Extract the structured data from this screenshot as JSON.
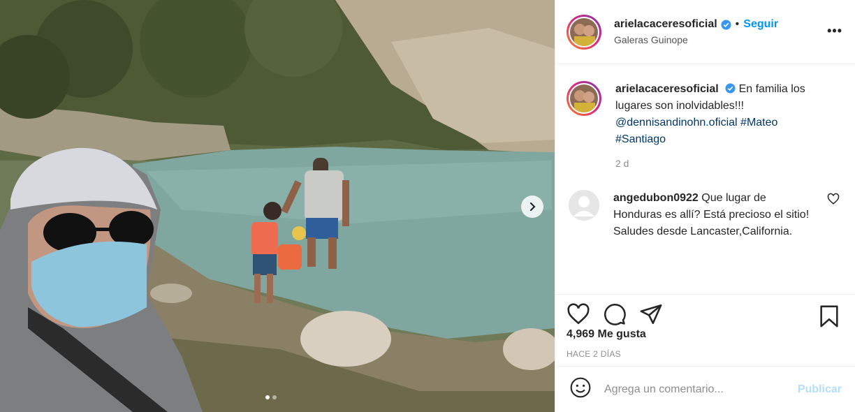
{
  "post": {
    "username": "arielacaceresoficial",
    "follow_label": "Seguir",
    "separator": "•",
    "location": "Galeras Guinope",
    "more_label": "•••"
  },
  "caption": {
    "username": "arielacaceresoficial",
    "text": "En familia los lugares son inolvidables!!!",
    "mention": "@dennisandinohn.oficial",
    "hashtag1": "#Mateo",
    "hashtag2": "#Santiago",
    "ago": "2 d"
  },
  "comment": {
    "username": "angedubon0922",
    "text": "Que lugar de Honduras es allí? Está precioso el sitio! Saludes desde Lancaster,California."
  },
  "stats": {
    "likes": "4,969 Me gusta",
    "date": "HACE 2 DÍAS"
  },
  "add_comment": {
    "placeholder": "Agrega un comentario...",
    "publish_label": "Publicar"
  },
  "colors": {
    "accent": "#0095f6",
    "publish_disabled": "#b2dffc",
    "link": "#00376b",
    "muted": "#8e8e8e"
  },
  "carousel": {
    "dots_total": 2,
    "active_dot": 1
  }
}
